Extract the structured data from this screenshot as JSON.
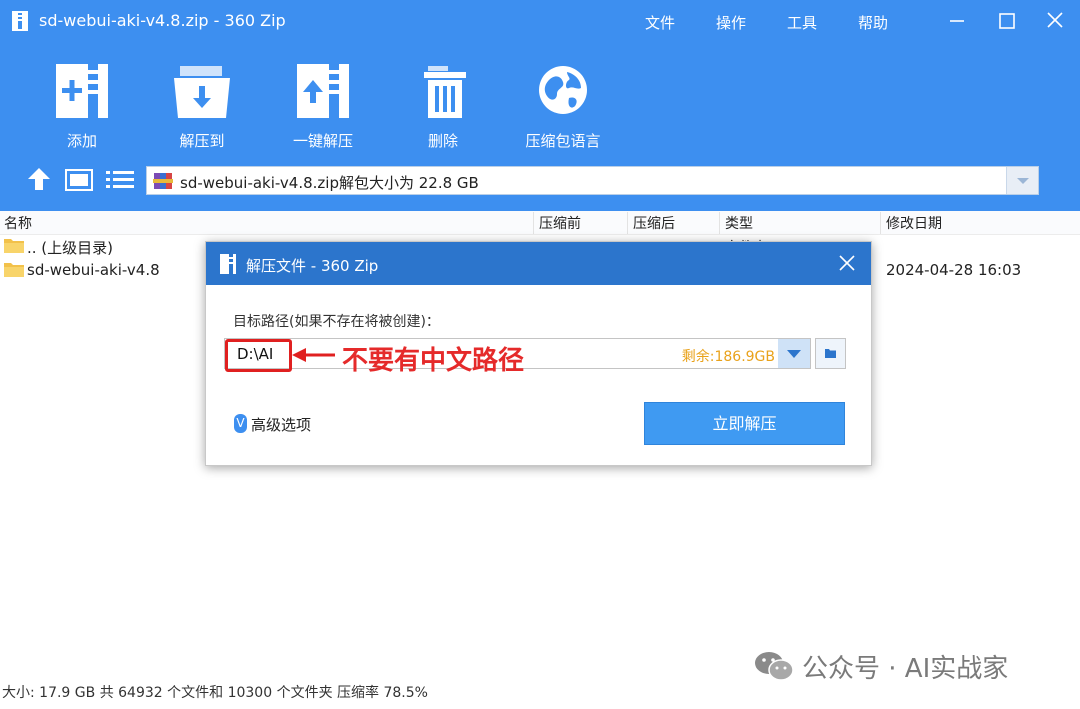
{
  "window": {
    "title": "sd-webui-aki-v4.8.zip - 360 Zip",
    "menu": [
      "文件",
      "操作",
      "工具",
      "帮助"
    ]
  },
  "toolbar": {
    "items": [
      {
        "label": "添加",
        "icon": "add-file-icon"
      },
      {
        "label": "解压到",
        "icon": "extract-to-icon"
      },
      {
        "label": "一键解压",
        "icon": "one-click-extract-icon"
      },
      {
        "label": "删除",
        "icon": "trash-icon"
      },
      {
        "label": "压缩包语言",
        "icon": "globe-icon"
      }
    ]
  },
  "pathbar": {
    "text": "sd-webui-aki-v4.8.zip解包大小为 22.8 GB"
  },
  "file_list": {
    "columns": [
      "名称",
      "压缩前",
      "压缩后",
      "类型",
      "修改日期"
    ],
    "rows": [
      {
        "name": ".. (上级目录)",
        "type": "文件夹",
        "modified": ""
      },
      {
        "name": "sd-webui-aki-v4.8",
        "type": "",
        "modified": "2024-04-28 16:03"
      }
    ]
  },
  "status": "大小: 17.9 GB 共 64932 个文件和 10300 个文件夹 压缩率 78.5%",
  "watermark": "公众号 · AI实战家",
  "dialog": {
    "title": "解压文件 - 360 Zip",
    "target_label": "目标路径(如果不存在将被创建)：",
    "path_value": "D:\\AI",
    "free_space": "剩余:186.9GB",
    "annotation": "不要有中文路径",
    "advanced_label": "高级选项",
    "advanced_icon_text": "V",
    "extract_button": "立即解压"
  },
  "colors": {
    "header_blue": "#3d8ff0",
    "dialog_title_blue": "#2c75cc",
    "annotation_red": "#e02020",
    "free_space_orange": "#e9a21b"
  }
}
